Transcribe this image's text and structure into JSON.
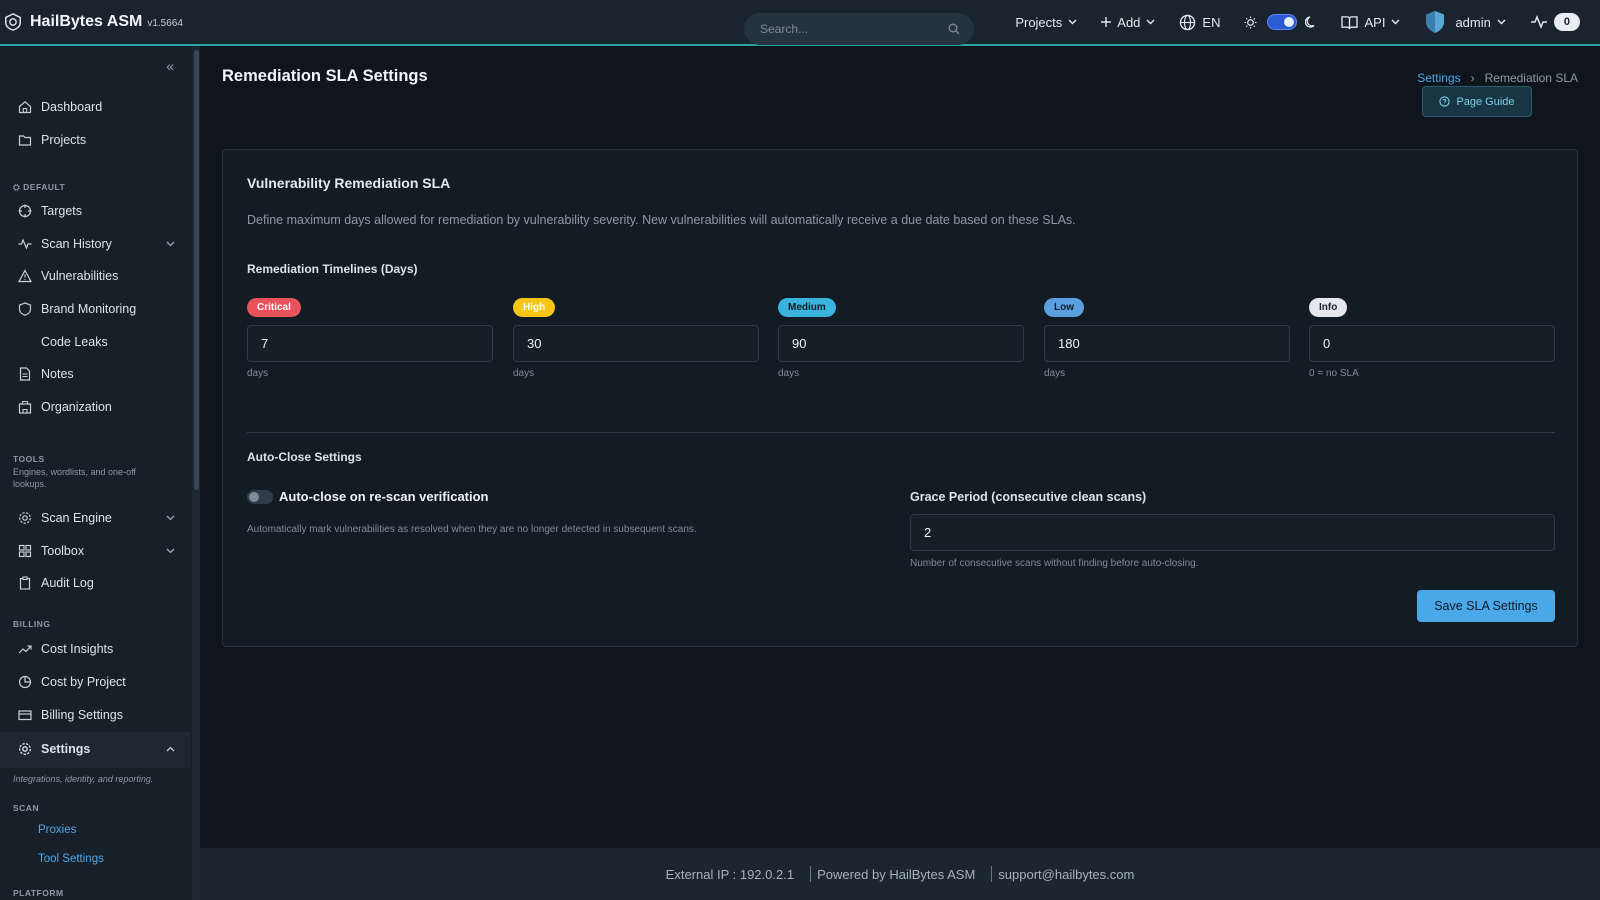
{
  "brand": {
    "name": "HailBytes ASM",
    "version": "v1.5664"
  },
  "topbar": {
    "search_placeholder": "Search...",
    "projects_label": "Projects",
    "add_label": "Add",
    "language": "EN",
    "api_label": "API",
    "user": "admin",
    "activity_count": "0"
  },
  "sidebar": {
    "items": {
      "dashboard": "Dashboard",
      "projects": "Projects",
      "targets": "Targets",
      "scan_history": "Scan History",
      "vulnerabilities": "Vulnerabilities",
      "brand_monitoring": "Brand Monitoring",
      "code_leaks": "Code Leaks",
      "notes": "Notes",
      "organization": "Organization",
      "scan_engine": "Scan Engine",
      "toolbox": "Toolbox",
      "audit_log": "Audit Log",
      "cost_insights": "Cost Insights",
      "cost_by_project": "Cost by Project",
      "billing_settings": "Billing Settings",
      "settings": "Settings"
    },
    "sections": {
      "default": "DEFAULT",
      "tools": "TOOLS",
      "tools_sub": "Engines, wordlists, and one-off lookups.",
      "billing": "BILLING",
      "settings_note": "Integrations, identity, and reporting.",
      "scan": "SCAN",
      "platform": "PLATFORM"
    },
    "sub_links": {
      "proxies": "Proxies",
      "tool_settings": "Tool Settings"
    }
  },
  "page": {
    "title": "Remediation SLA Settings",
    "breadcrumb": {
      "parent": "Settings",
      "current": "Remediation SLA"
    },
    "guide_label": "Page Guide"
  },
  "card": {
    "title": "Vulnerability Remediation SLA",
    "description": "Define maximum days allowed for remediation by vulnerability severity. New vulnerabilities will automatically receive a due date based on these SLAs.",
    "timelines_heading": "Remediation Timelines (Days)",
    "severities": [
      {
        "label": "Critical",
        "value": "7",
        "hint": "days",
        "color": "#e8525a"
      },
      {
        "label": "High",
        "value": "30",
        "hint": "days",
        "color": "#f5c518"
      },
      {
        "label": "Medium",
        "value": "90",
        "hint": "days",
        "color": "#3ab4de"
      },
      {
        "label": "Low",
        "value": "180",
        "hint": "days",
        "color": "#5a9fe0"
      },
      {
        "label": "Info",
        "value": "0",
        "hint": "0 = no SLA",
        "color": "#e4e8ec"
      }
    ],
    "auto_close_heading": "Auto-Close Settings",
    "auto_close_label": "Auto-close on re-scan verification",
    "auto_close_hint": "Automatically mark vulnerabilities as resolved when they are no longer detected in subsequent scans.",
    "grace_label": "Grace Period (consecutive clean scans)",
    "grace_value": "2",
    "grace_hint": "Number of consecutive scans without finding before auto-closing.",
    "save_label": "Save SLA Settings"
  },
  "footer": {
    "external_ip": "External IP : 192.0.2.1",
    "powered_by": "Powered by HailBytes ASM",
    "support": "support@hailbytes.com"
  }
}
